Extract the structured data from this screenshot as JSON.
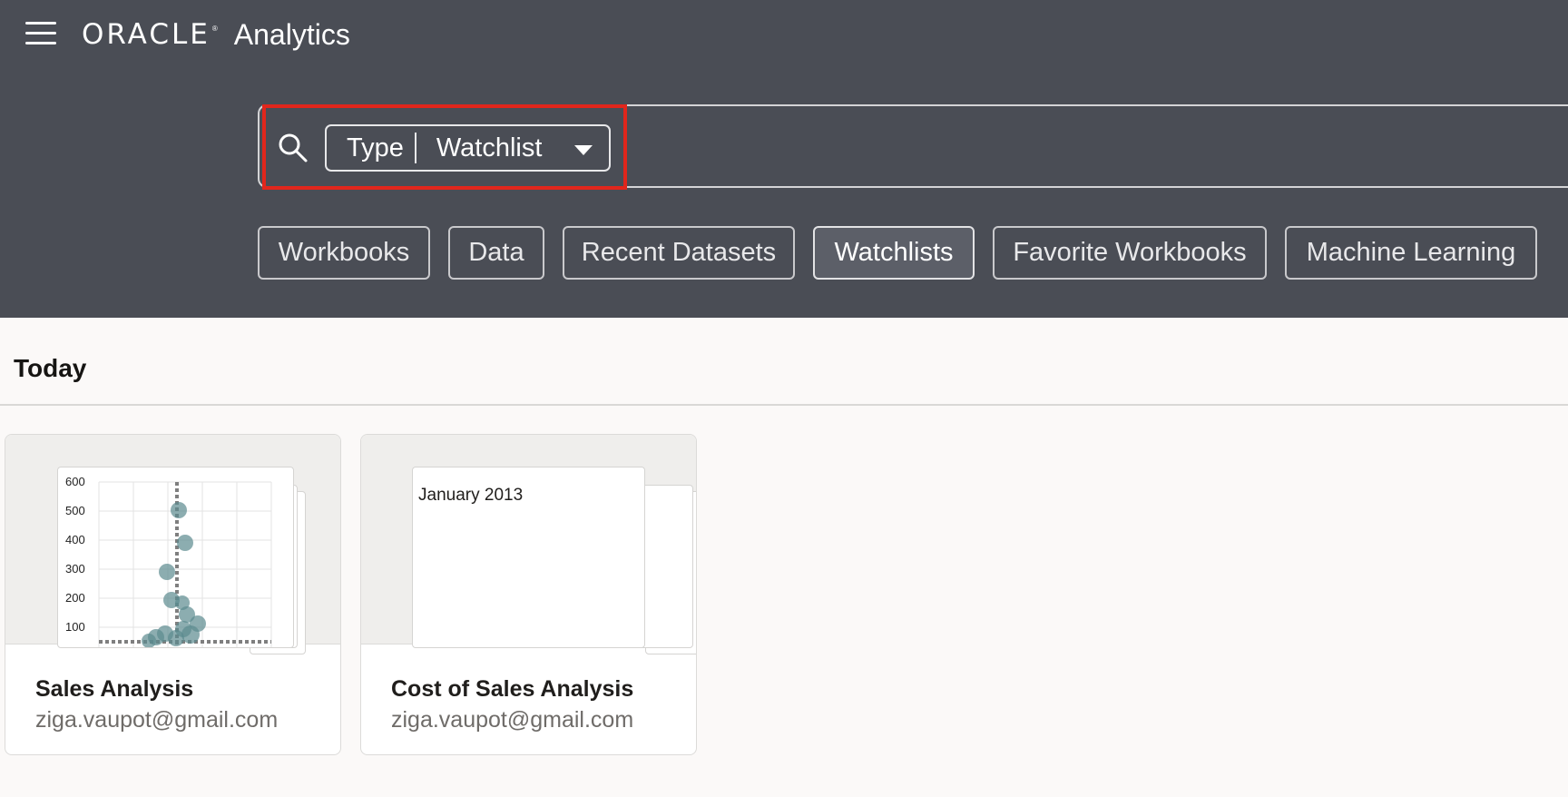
{
  "header": {
    "brand": "ORACLE",
    "brand_mark": "®",
    "product": "Analytics"
  },
  "search": {
    "type_label": "Type",
    "type_value": "Watchlist"
  },
  "filters": [
    "Workbooks",
    "Data",
    "Recent Datasets",
    "Watchlists",
    "Favorite Workbooks",
    "Machine Learning"
  ],
  "active_filter": "Watchlists",
  "section": {
    "title": "Today"
  },
  "cards": [
    {
      "title": "Sales Analysis",
      "owner": "ziga.vaupot@gmail.com",
      "thumbnail_y_ticks": [
        "600",
        "500",
        "400",
        "300",
        "200",
        "100"
      ]
    },
    {
      "title": "Cost of Sales Analysis",
      "owner": "ziga.vaupot@gmail.com",
      "thumbnail_text": "January 2013"
    }
  ],
  "colors": {
    "header_bg": "#4a4d55",
    "highlight": "#e1261c",
    "marker": "#5b8a8f"
  }
}
